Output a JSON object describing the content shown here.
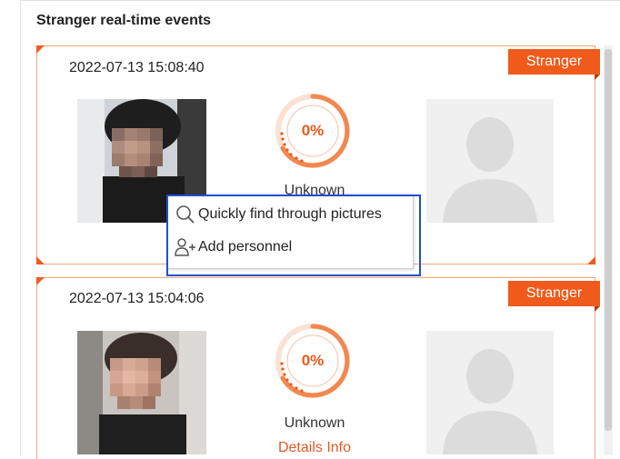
{
  "panel": {
    "title": "Stranger real-time events"
  },
  "events": [
    {
      "timestamp": "2022-07-13 15:08:40",
      "badge": "Stranger",
      "similarity": "0%",
      "result": "Unknown",
      "details_link": ""
    },
    {
      "timestamp": "2022-07-13 15:04:06",
      "badge": "Stranger",
      "similarity": "0%",
      "result": "Unknown",
      "details_link": "Details Info"
    }
  ],
  "context_menu": {
    "items": [
      {
        "label": "Quickly find through pictures",
        "icon": "magnifier-icon"
      },
      {
        "label": "Add personnel",
        "icon": "add-person-icon"
      }
    ]
  },
  "colors": {
    "accent": "#f05a1a",
    "card_border": "#f4a876",
    "highlight": "#1f4fd0"
  }
}
